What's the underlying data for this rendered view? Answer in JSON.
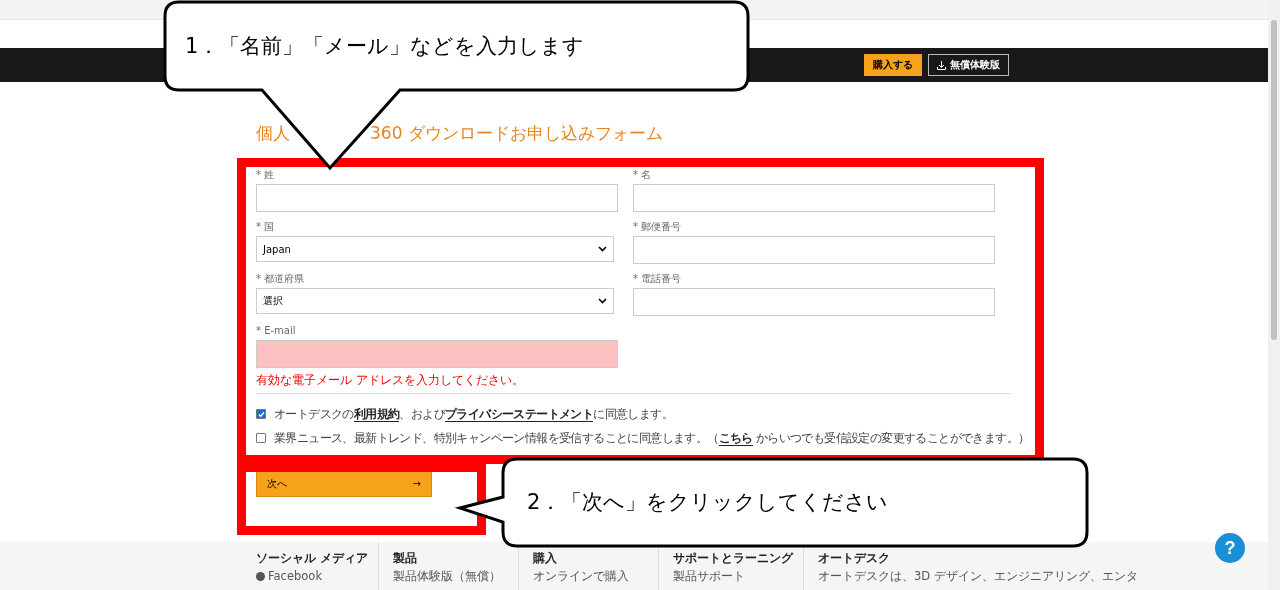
{
  "header": {
    "buttons": [
      {
        "label": "購入する",
        "kind": "primary"
      },
      {
        "label": "無償体験版",
        "kind": "download"
      }
    ]
  },
  "form": {
    "title_parts": [
      "個人",
      "360 ダウンロードお申し込みフォーム"
    ],
    "fields": [
      {
        "label": "* 姓",
        "kind": "text"
      },
      {
        "label": "* 名",
        "kind": "text"
      },
      {
        "label": "* 国",
        "kind": "select",
        "value": "Japan"
      },
      {
        "label": "* 郵便番号",
        "kind": "text"
      },
      {
        "label": "* 都道府県",
        "kind": "select",
        "value": "選択"
      },
      {
        "label": "* 電話番号",
        "kind": "text"
      },
      {
        "label": "* E-mail",
        "kind": "text",
        "invalid": true,
        "error": "有効な電子メール アドレスを入力してください。"
      }
    ],
    "consents": [
      {
        "checked": true,
        "segments": [
          {
            "kind": "text",
            "text": "オートデスクの"
          },
          {
            "kind": "link",
            "text": "利用規約"
          },
          {
            "kind": "text",
            "text": "、および"
          },
          {
            "kind": "link",
            "text": "プライバシーステートメント"
          },
          {
            "kind": "text",
            "text": "に同意します。"
          }
        ]
      },
      {
        "checked": false,
        "segments": [
          {
            "kind": "text",
            "text": "業界ニュース、最新トレンド、特別キャンペーン情報を受信することに同意します。（"
          },
          {
            "kind": "link",
            "text": "こちら"
          },
          {
            "kind": "text",
            "text": " からいつでも受信設定の変更することができます。）"
          }
        ]
      }
    ],
    "next_button": {
      "label": "次へ",
      "arrow": "→"
    }
  },
  "footer": {
    "columns": [
      {
        "heading": "ソーシャル メディア",
        "item": "Facebook",
        "kind": "social"
      },
      {
        "heading": "製品",
        "item": "製品体験版（無償）",
        "kind": "plain"
      },
      {
        "heading": "購入",
        "item": "オンラインで購入",
        "kind": "plain"
      },
      {
        "heading": "サポートとラーニング",
        "item": "製品サポート",
        "kind": "plain"
      },
      {
        "heading": "オートデスク",
        "item": "オートデスクは、3D デザイン、エンジニアリング、エンタ",
        "kind": "plain"
      }
    ]
  },
  "help_button": {
    "label": "?"
  },
  "callouts": [
    {
      "text": "1．「名前」「メール」などを入力します",
      "kind": "down"
    },
    {
      "text": "2．「次へ」をクリックしてください",
      "kind": "left"
    }
  ]
}
